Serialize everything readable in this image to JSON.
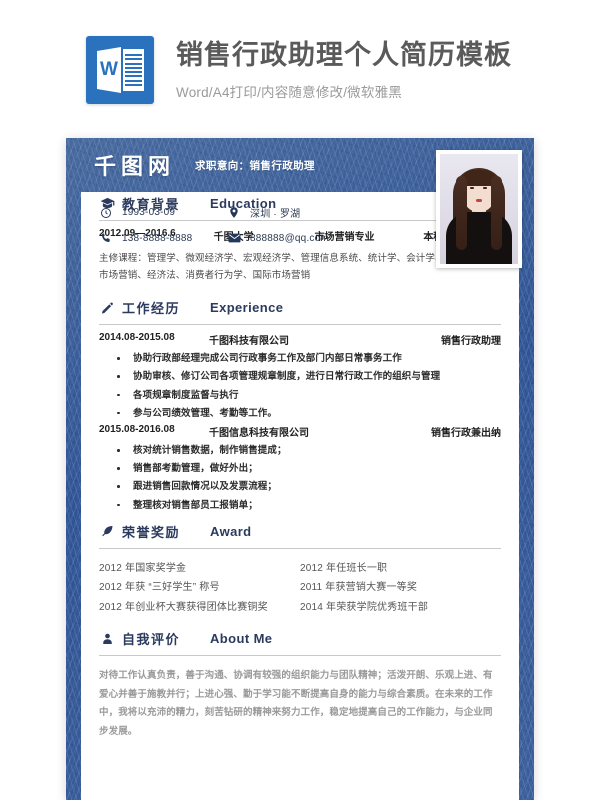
{
  "promo": {
    "logo_letter": "W",
    "title": "销售行政助理个人简历模板",
    "subtitle": "Word/A4打印/内容随意修改/微软雅黑"
  },
  "resume": {
    "brand": "千图网",
    "objective": "求职意向：销售行政助理",
    "contact": {
      "birthday": "1993-03-09",
      "location": "深圳 · 罗湖",
      "phone": "138-8888-8888",
      "email": "888888@qq.com"
    },
    "sections": {
      "education": {
        "cn": "教育背景",
        "en": "Education",
        "row": {
          "period": "2012.09—2016.6",
          "school": "千图大学",
          "major": "市场营销专业",
          "degree": "本科学历"
        },
        "courses": "主修课程：管理学、微观经济学、宏观经济学、管理信息系统、统计学、会计学、财务管理、市场营销、经济法、消费者行为学、国际市场营销"
      },
      "experience": {
        "cn": "工作经历",
        "en": "Experience",
        "jobs": [
          {
            "period": "2014.08-2015.08",
            "company": "千图科技有限公司",
            "role": "销售行政助理",
            "duties": [
              "协助行政部经理完成公司行政事务工作及部门内部日常事务工作",
              "协助审核、修订公司各项管理规章制度，进行日常行政工作的组织与管理",
              "各项规章制度监督与执行",
              "参与公司绩效管理、考勤等工作。"
            ]
          },
          {
            "period": "2015.08-2016.08",
            "company": "千图信息科技有限公司",
            "role": "销售行政兼出纳",
            "duties": [
              "核对统计销售数据，制作销售提成；",
              "销售部考勤管理，做好外出；",
              "跟进销售回款情况以及发票流程；",
              "整理核对销售部员工报销单；"
            ]
          }
        ]
      },
      "award": {
        "cn": "荣誉奖励",
        "en": "Award",
        "left": [
          "2012 年国家奖学金",
          "2012 年获 “三好学生” 称号",
          "2012 年创业杯大赛获得团体比赛铜奖"
        ],
        "right": [
          "2012 年任班长一职",
          "2011 年获营销大赛一等奖",
          "2014 年荣获学院优秀班干部"
        ]
      },
      "about": {
        "cn": "自我评价",
        "en": "About Me",
        "text": "对待工作认真负责，善于沟通、协调有较强的组织能力与团队精神；活泼开朗、乐观上进、有爱心并善于施教并行；上进心强、勤于学习能不断提高自身的能力与综合素质。在未来的工作中，我将以充沛的精力，刻苦钻研的精神来努力工作，稳定地提高自己的工作能力，与企业同步发展。"
      }
    }
  },
  "colors": {
    "denim_blue": "#3a5f9e",
    "heading_navy": "#2b3a5e",
    "word_blue": "#2a72bd"
  }
}
